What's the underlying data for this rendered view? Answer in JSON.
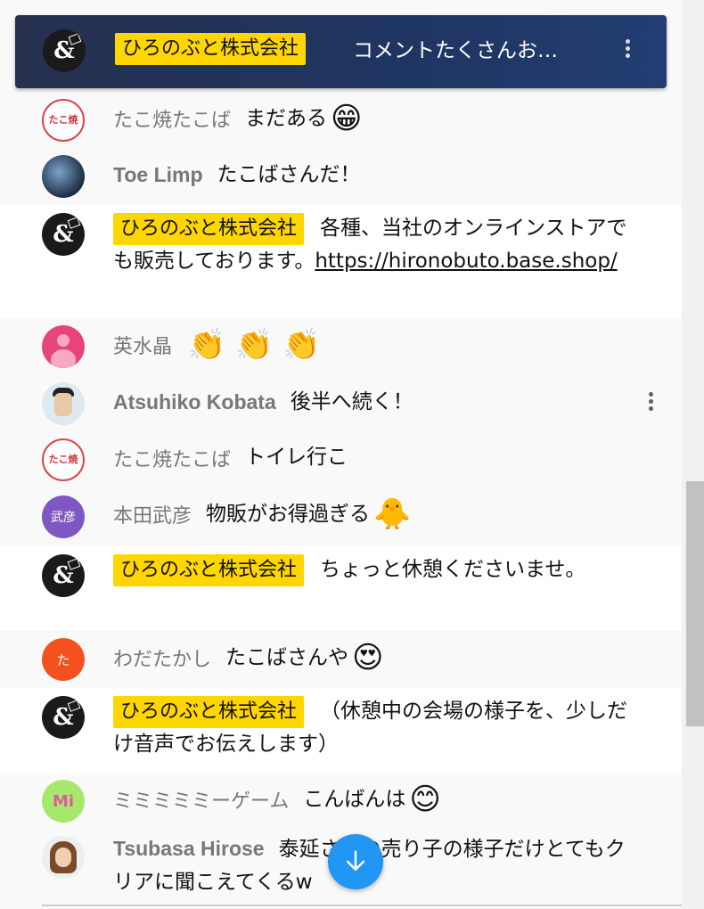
{
  "banner": {
    "channel": "ひろのぶと株式会社",
    "text": "コメントたくさんお…"
  },
  "messages": [
    {
      "author": "たこ焼たこば",
      "text": "まだある",
      "emoji": "😁"
    },
    {
      "author": "Toe Limp",
      "text": "たこばさんだ！"
    },
    {
      "author": "ひろのぶと株式会社",
      "text": "各種、当社のオンラインストアでも販売しております。",
      "link": "https://hironobuto.base.shop/"
    },
    {
      "author": "英水晶",
      "emoji": "👏 👏 👏"
    },
    {
      "author": "Atsuhiko Kobata",
      "text": "後半へ続く！"
    },
    {
      "author": "たこ焼たこば",
      "text": "トイレ行こ"
    },
    {
      "author": "本田武彦",
      "text": "物販がお得過ぎる",
      "emoji": "🐥"
    },
    {
      "author": "ひろのぶと株式会社",
      "text": "ちょっと休憩くださいませ。"
    },
    {
      "author": "わだたかし",
      "text": "たこばさんや",
      "emoji": "😍"
    },
    {
      "author": "ひろのぶと株式会社",
      "text": "（休憩中の会場の様子を、少しだけ音声でお伝えします）"
    },
    {
      "author": "ミミミミミーゲーム",
      "text": "こんばんは",
      "emoji": "😊"
    },
    {
      "author": "Tsubasa Hirose",
      "text": "泰延さんの売り子の様子だけとてもクリアに聞こえてくるw"
    }
  ],
  "avatars": {
    "amp": "&",
    "tako": "たこ焼",
    "honda": "武彦",
    "wada": "た",
    "mimi": "Mi"
  },
  "icons": {
    "menu": "more-vert-icon",
    "scroll": "arrow-down-icon"
  },
  "colors": {
    "owner_badge": "#ffd600",
    "banner": "#1f3562",
    "scroll_button": "#2196f3"
  }
}
